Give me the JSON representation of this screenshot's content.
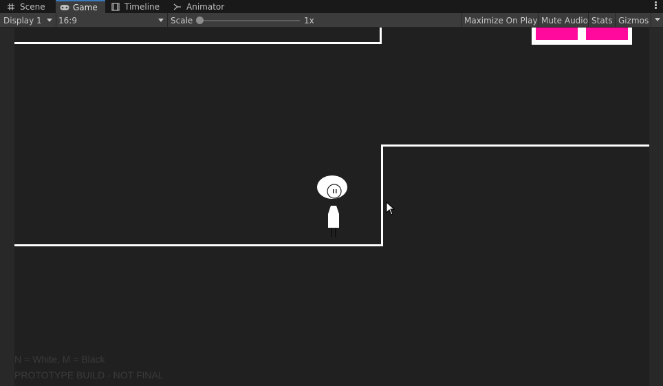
{
  "tabs": [
    {
      "label": "Scene",
      "icon": "grid-icon",
      "active": false
    },
    {
      "label": "Game",
      "icon": "gamepad-icon",
      "active": true
    },
    {
      "label": "Timeline",
      "icon": "film-icon",
      "active": false
    },
    {
      "label": "Animator",
      "icon": "animator-icon",
      "active": false
    }
  ],
  "toolbar": {
    "display": "Display 1",
    "aspect": "16:9",
    "scale_label": "Scale",
    "scale_value": "1x",
    "scale_level": 0.0,
    "maximize_label": "Maximize On Play",
    "mute_label": "Mute Audio",
    "stats_label": "Stats",
    "gizmos_label": "Gizmos"
  },
  "game": {
    "background": "#202020",
    "line_color": "#ffffff",
    "hud_block_color": "#ff0a9c",
    "hint_text": "N = White, M = Black",
    "build_text": "PROTOTYPE BUILD - NOT FINAL"
  }
}
